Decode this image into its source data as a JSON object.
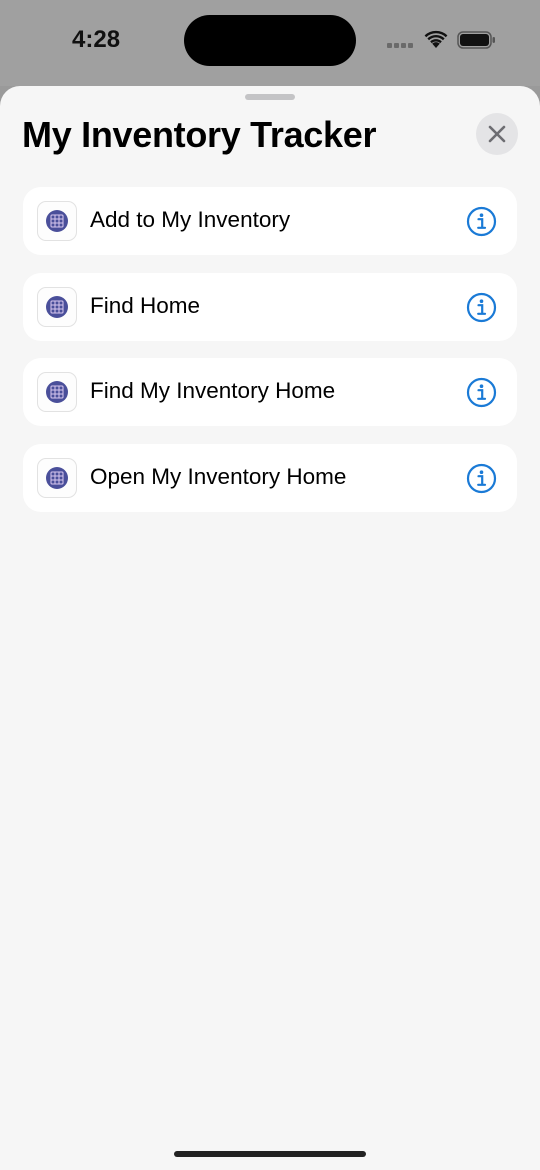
{
  "status_bar": {
    "time": "4:28",
    "icons": [
      "cellular-signal-icon",
      "wifi-icon",
      "battery-icon"
    ]
  },
  "sheet": {
    "title": "My Inventory Tracker",
    "close_icon": "close-icon",
    "items": [
      {
        "label": "Add to My Inventory",
        "icon": "app-grid-icon",
        "info_icon": "info-icon"
      },
      {
        "label": "Find Home",
        "icon": "app-grid-icon",
        "info_icon": "info-icon"
      },
      {
        "label": "Find My Inventory Home",
        "icon": "app-grid-icon",
        "info_icon": "info-icon"
      },
      {
        "label": "Open My Inventory Home",
        "icon": "app-grid-icon",
        "info_icon": "info-icon"
      }
    ]
  },
  "colors": {
    "accent": "#1a7ad6",
    "sheet_background": "#f6f6f6",
    "row_background": "#ffffff",
    "app_icon_fill": "#4a4f9a"
  }
}
